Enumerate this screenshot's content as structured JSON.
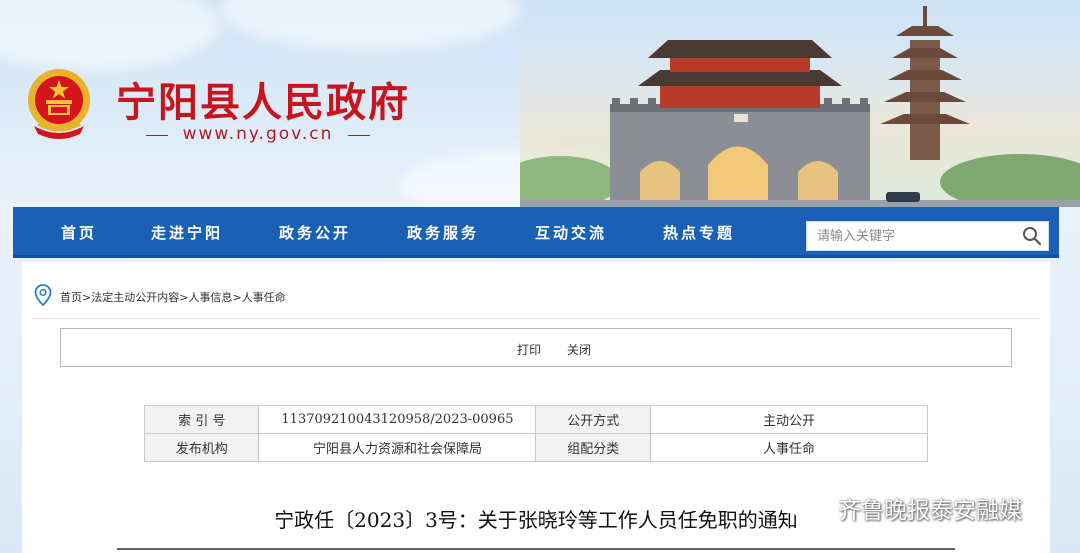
{
  "header": {
    "site_name": "宁阳县人民政府",
    "site_url": "www.ny.gov.cn",
    "emblem_icon": "national-emblem-icon",
    "colors": {
      "brand_red": "#c8141c",
      "nav_blue": "#1a60b5"
    }
  },
  "nav": {
    "items": [
      {
        "label": "首页"
      },
      {
        "label": "走进宁阳"
      },
      {
        "label": "政务公开"
      },
      {
        "label": "政务服务"
      },
      {
        "label": "互动交流"
      },
      {
        "label": "热点专题"
      }
    ],
    "search": {
      "placeholder": "请输入关键字",
      "value": "",
      "icon": "search-icon"
    }
  },
  "breadcrumb": {
    "icon": "location-pin-icon",
    "items": [
      "首页",
      "法定主动公开内容",
      "人事信息",
      "人事任命"
    ],
    "separator": ">"
  },
  "toolbar": {
    "print_label": "打印",
    "close_label": "关闭"
  },
  "meta": {
    "rows": [
      {
        "k1": "索 引 号",
        "v1": "11370921004312095​8/2023-00965",
        "k2": "公开方式",
        "v2": "主动公开"
      },
      {
        "k1": "发布机构",
        "v1": "宁阳县人力资源和社会保障局",
        "k2": "组配分类",
        "v2": "人事任命"
      }
    ]
  },
  "document": {
    "title": "宁政任〔2023〕3号：关于张晓玲等工作人员任免职的通知"
  },
  "watermark": {
    "text": "齐鲁晚报泰安融媒"
  }
}
